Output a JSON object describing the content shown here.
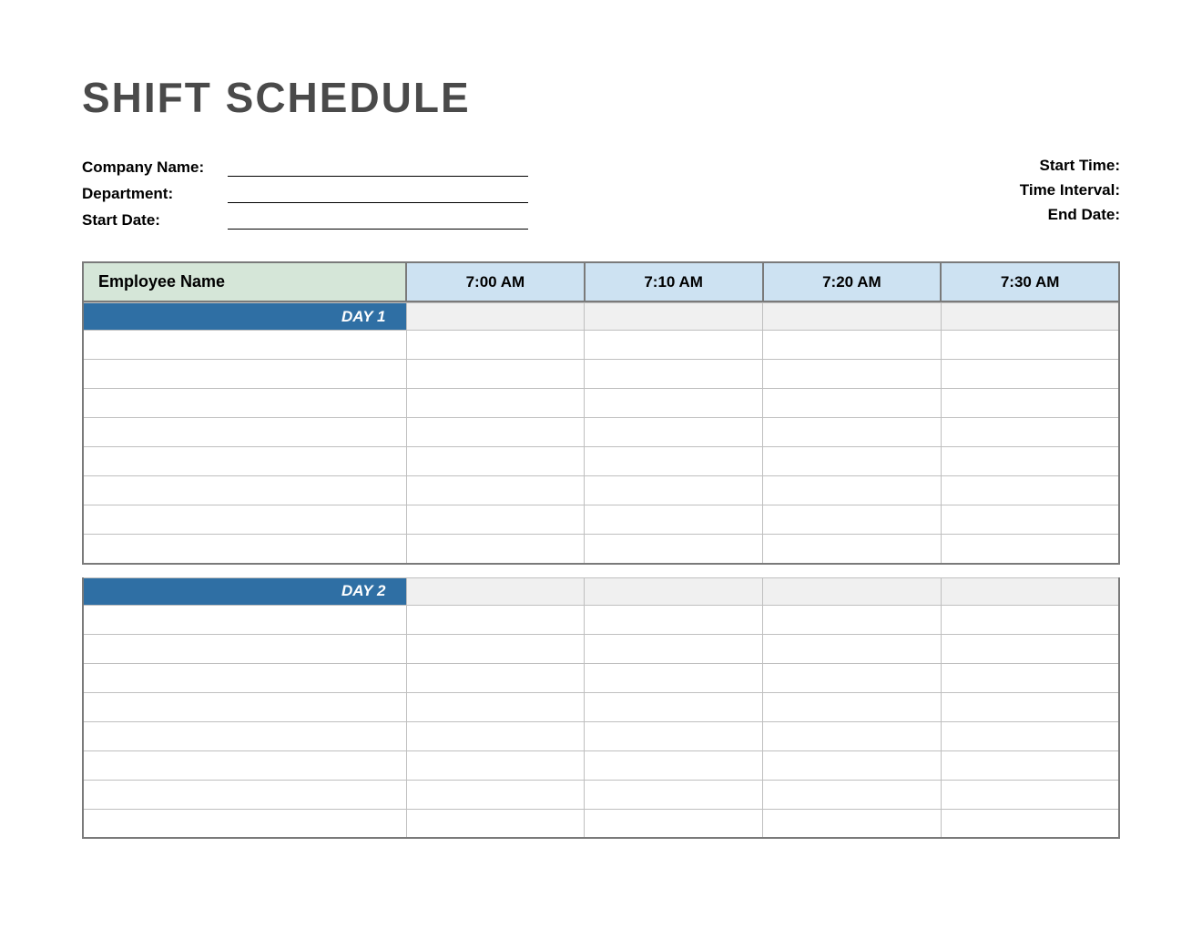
{
  "title": "SHIFT SCHEDULE",
  "meta_left": {
    "company": "Company Name:",
    "department": "Department:",
    "start_date": "Start Date:"
  },
  "meta_right": {
    "start_time": "Start Time:",
    "time_interval": "Time Interval:",
    "end_date": "End Date:"
  },
  "headers": {
    "employee": "Employee Name",
    "times": [
      "7:00 AM",
      "7:10 AM",
      "7:20 AM",
      "7:30 AM"
    ]
  },
  "sections": [
    {
      "label": "DAY 1",
      "rows": 8
    },
    {
      "label": "DAY 2",
      "rows": 8
    }
  ]
}
